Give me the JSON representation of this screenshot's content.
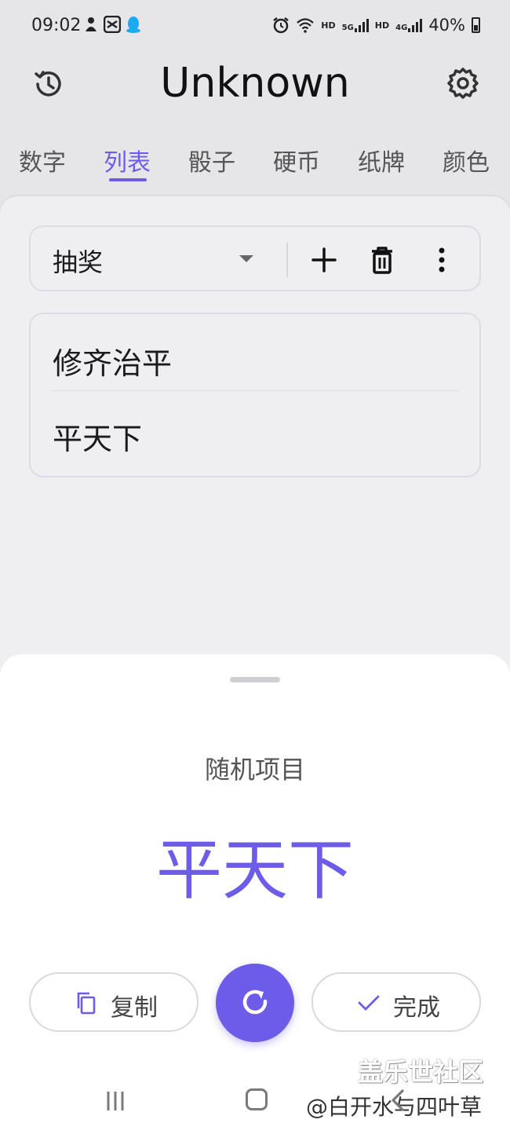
{
  "status_bar": {
    "time": "09:02",
    "battery": "40%",
    "network_labels": [
      "HD",
      "5G",
      "HD",
      "4G"
    ]
  },
  "app_bar": {
    "title": "Unknown"
  },
  "tabs": [
    {
      "label": "数字",
      "active": false
    },
    {
      "label": "列表",
      "active": true
    },
    {
      "label": "骰子",
      "active": false
    },
    {
      "label": "硬币",
      "active": false
    },
    {
      "label": "纸牌",
      "active": false
    },
    {
      "label": "颜色",
      "active": false
    }
  ],
  "list_selector": {
    "selected": "抽奖"
  },
  "list_items": [
    "修齐治平",
    "平天下"
  ],
  "result_sheet": {
    "label": "随机项目",
    "value": "平天下",
    "copy_label": "复制",
    "done_label": "完成"
  },
  "watermark": {
    "line1": "盖乐世社区",
    "line2": "@白开水与四叶草"
  },
  "colors": {
    "accent": "#6c5ce7",
    "background": "#e6e6e9",
    "sheet": "#ffffff"
  }
}
